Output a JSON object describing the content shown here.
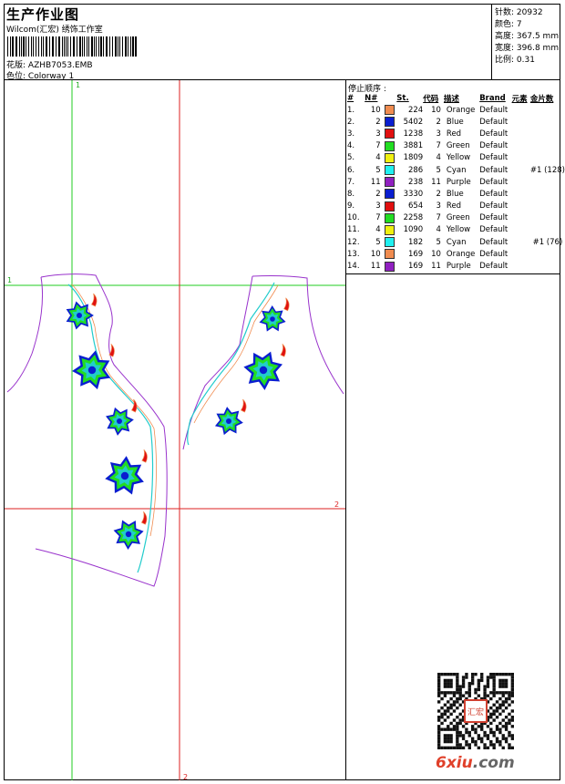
{
  "header": {
    "title": "生产作业图",
    "subtitle": "Wilcom(汇宏) 绣饰工作室",
    "design": {
      "label": "花版:",
      "value": "AZHB7053.EMB"
    },
    "colorway": {
      "label": "色位:",
      "value": "Colorway 1"
    }
  },
  "stats": {
    "stitches": {
      "label": "针数:",
      "value": "20932"
    },
    "colors": {
      "label": "颜色:",
      "value": "7"
    },
    "height": {
      "label": "高度:",
      "value": "367.5 mm"
    },
    "width": {
      "label": "宽度:",
      "value": "396.8 mm"
    },
    "scale": {
      "label": "比例:",
      "value": "0.31"
    }
  },
  "sequence": {
    "title": "停止顺序 :",
    "headers": {
      "idx": "#",
      "n": "N#",
      "st": "St.",
      "code": "代码",
      "desc": "描述",
      "brand": "Brand",
      "element": "元素",
      "sequin": "金片数"
    },
    "rows": [
      {
        "idx": "1.",
        "n": "10",
        "color": "#f08c50",
        "st": "224",
        "code": "10",
        "desc": "Orange",
        "brand": "Default",
        "sequin": ""
      },
      {
        "idx": "2.",
        "n": "2",
        "color": "#0a1ed0",
        "st": "5402",
        "code": "2",
        "desc": "Blue",
        "brand": "Default",
        "sequin": ""
      },
      {
        "idx": "3.",
        "n": "3",
        "color": "#e01010",
        "st": "1238",
        "code": "3",
        "desc": "Red",
        "brand": "Default",
        "sequin": ""
      },
      {
        "idx": "4.",
        "n": "7",
        "color": "#22dd22",
        "st": "3881",
        "code": "7",
        "desc": "Green",
        "brand": "Default",
        "sequin": ""
      },
      {
        "idx": "5.",
        "n": "4",
        "color": "#f0f010",
        "st": "1809",
        "code": "4",
        "desc": "Yellow",
        "brand": "Default",
        "sequin": ""
      },
      {
        "idx": "6.",
        "n": "5",
        "color": "#20f0f0",
        "st": "286",
        "code": "5",
        "desc": "Cyan",
        "brand": "Default",
        "sequin": "#1 (128)"
      },
      {
        "idx": "7.",
        "n": "11",
        "color": "#9020c0",
        "st": "238",
        "code": "11",
        "desc": "Purple",
        "brand": "Default",
        "sequin": ""
      },
      {
        "idx": "8.",
        "n": "2",
        "color": "#0a1ed0",
        "st": "3330",
        "code": "2",
        "desc": "Blue",
        "brand": "Default",
        "sequin": ""
      },
      {
        "idx": "9.",
        "n": "3",
        "color": "#e01010",
        "st": "654",
        "code": "3",
        "desc": "Red",
        "brand": "Default",
        "sequin": ""
      },
      {
        "idx": "10.",
        "n": "7",
        "color": "#22dd22",
        "st": "2258",
        "code": "7",
        "desc": "Green",
        "brand": "Default",
        "sequin": ""
      },
      {
        "idx": "11.",
        "n": "4",
        "color": "#f0f010",
        "st": "1090",
        "code": "4",
        "desc": "Yellow",
        "brand": "Default",
        "sequin": ""
      },
      {
        "idx": "12.",
        "n": "5",
        "color": "#20f0f0",
        "st": "182",
        "code": "5",
        "desc": "Cyan",
        "brand": "Default",
        "sequin": "#1 (76)"
      },
      {
        "idx": "13.",
        "n": "10",
        "color": "#f08c50",
        "st": "169",
        "code": "10",
        "desc": "Orange",
        "brand": "Default",
        "sequin": ""
      },
      {
        "idx": "14.",
        "n": "11",
        "color": "#9020c0",
        "st": "169",
        "code": "11",
        "desc": "Purple",
        "brand": "Default",
        "sequin": ""
      }
    ]
  },
  "canvas": {
    "guide_labels": {
      "green_top": "1",
      "green_left": "1",
      "red_right": "2",
      "red_bottom": "2"
    },
    "colors": {
      "green_guide": "#22cc22",
      "red_guide": "#dd2222",
      "outline": "#9933cc",
      "cyan": "#22cccc",
      "blue": "#0a1ed0",
      "green": "#22dd22",
      "red": "#e01010",
      "orange": "#f08c50"
    }
  },
  "watermark": {
    "part1": "6xiu",
    "part2": ".com",
    "seal": "汇宏"
  }
}
